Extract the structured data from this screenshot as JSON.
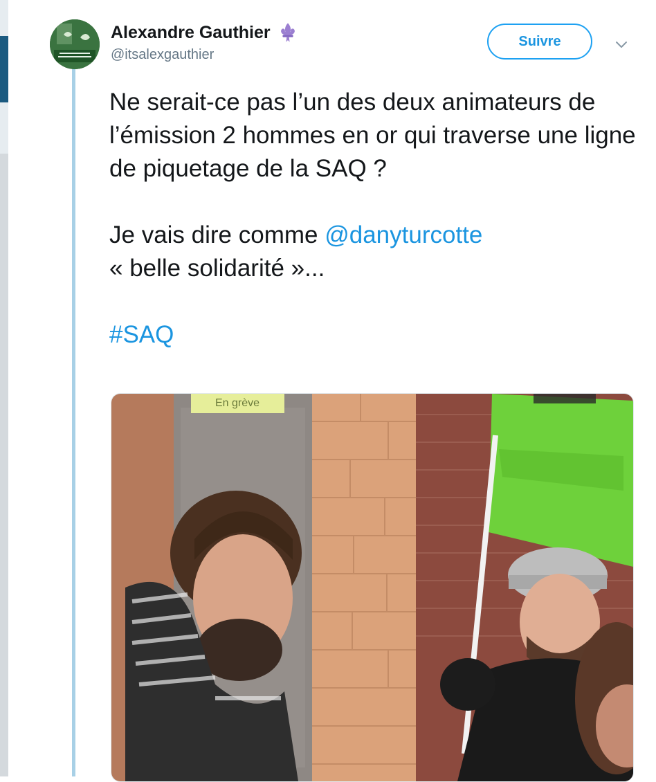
{
  "tweet": {
    "author": {
      "display_name": "Alexandre Gauthier",
      "handle": "@itsalexgauthier",
      "emoji": "fleur-de-lis",
      "avatar": "profile-photo"
    },
    "follow_label": "Suivre",
    "text": {
      "line1": "Ne serait-ce pas l’un des deux animateurs de l’émission 2 hommes en or qui traverse une ligne de piquetage de la SAQ ?",
      "line2_prefix": "Je vais dire comme ",
      "mention": "@danyturcotte",
      "line3": "« belle solidarité »...",
      "hashtag": "#SAQ"
    },
    "photo": {
      "sign_text": "En grève"
    }
  },
  "colors": {
    "link": "#1b95e0",
    "follow_border": "#1da1f2",
    "thread_line": "#a8d0e6",
    "flag_green": "#6ed13b"
  }
}
